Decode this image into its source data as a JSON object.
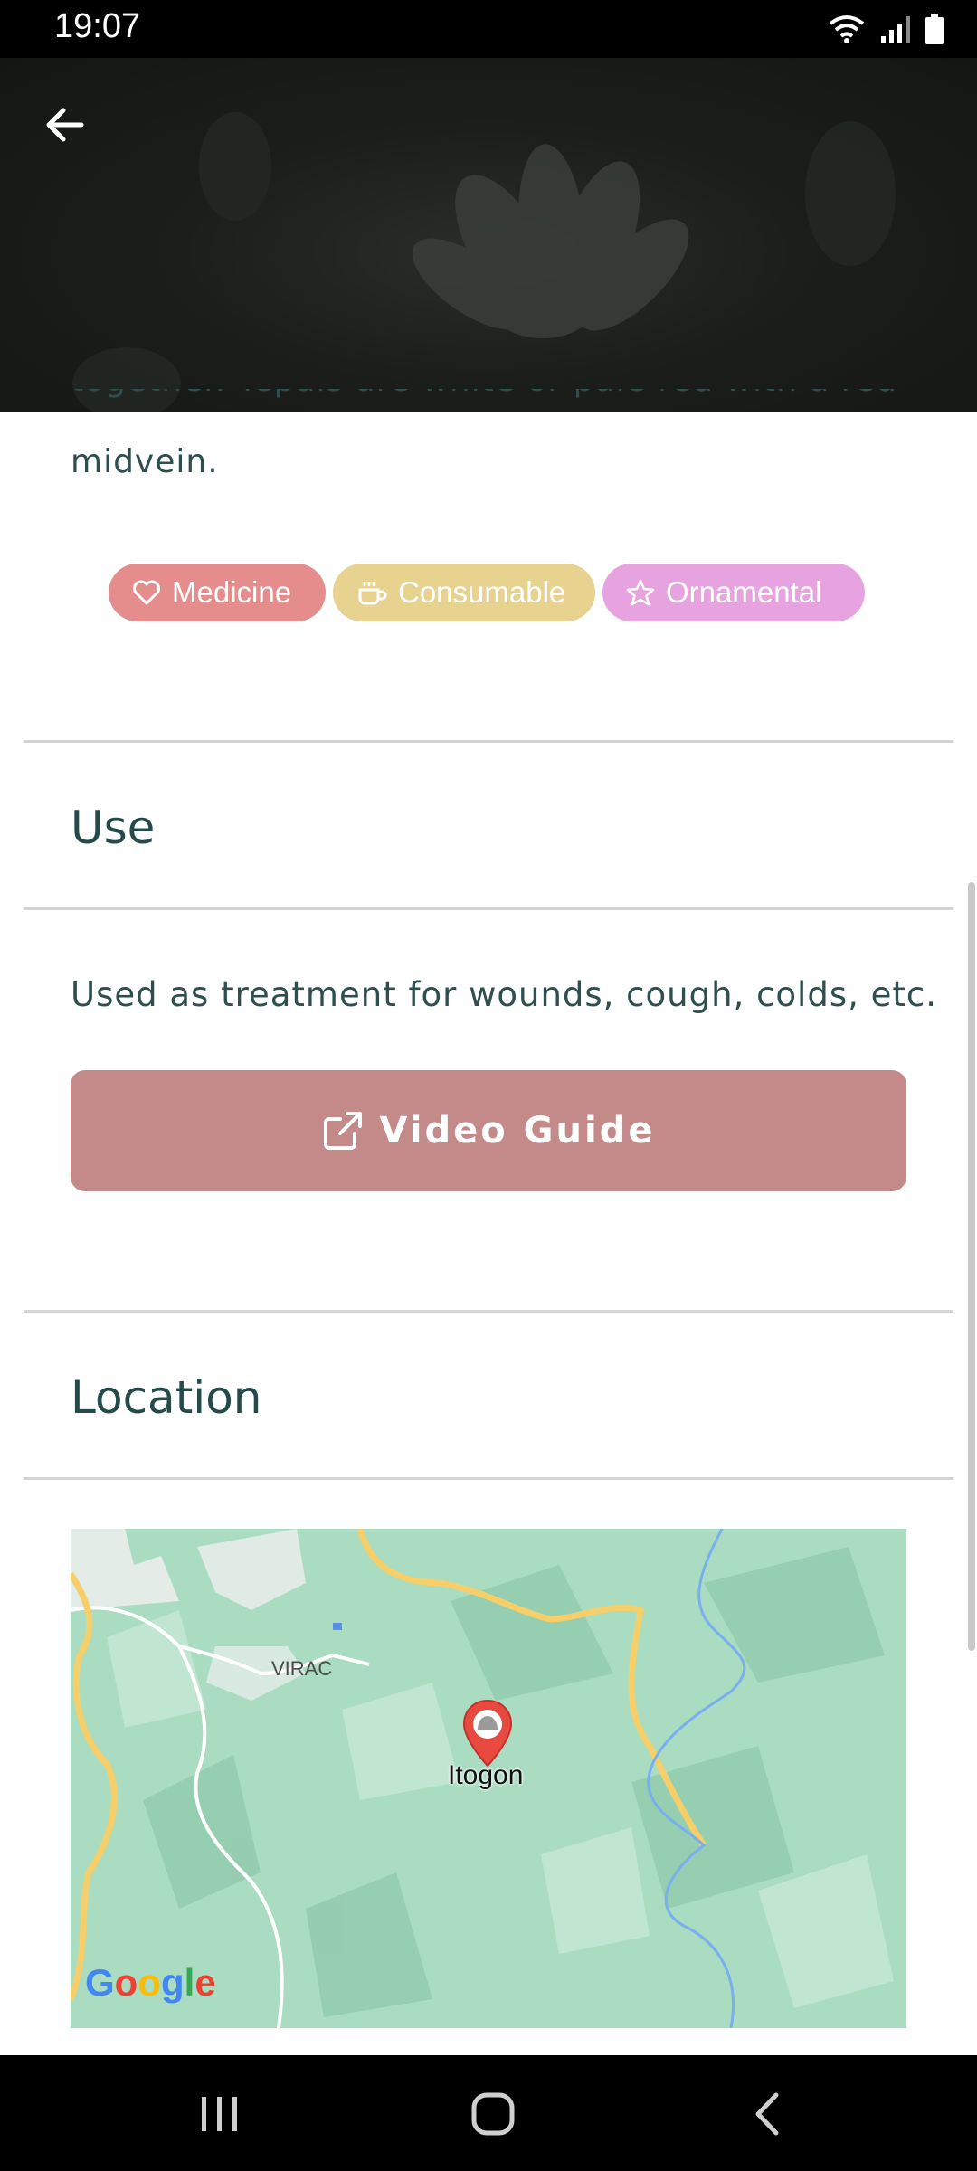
{
  "status_bar": {
    "time": "19:07"
  },
  "description": {
    "visible_line1": "together. Tepals are white or pale red with a red",
    "visible_line2": "midvein."
  },
  "tags": [
    {
      "label": "Medicine",
      "icon": "heart-icon",
      "color": "#e58d8d"
    },
    {
      "label": "Consumable",
      "icon": "cup-icon",
      "color": "#e7d28f"
    },
    {
      "label": "Ornamental",
      "icon": "star-icon",
      "color": "#e6a3df"
    }
  ],
  "use": {
    "title": "Use",
    "text": "Used as treatment for wounds, cough, colds, etc.",
    "video_button_label": "Video Guide",
    "video_button_icon": "external-link-icon",
    "button_color": "#c48a8a"
  },
  "location": {
    "title": "Location",
    "map": {
      "place_label": "Itogon",
      "area_label": "VIRAC",
      "attribution": "Google"
    }
  },
  "nav": {
    "recents_icon": "recents-icon",
    "home_icon": "home-icon",
    "back_icon": "back-chevron-icon"
  }
}
